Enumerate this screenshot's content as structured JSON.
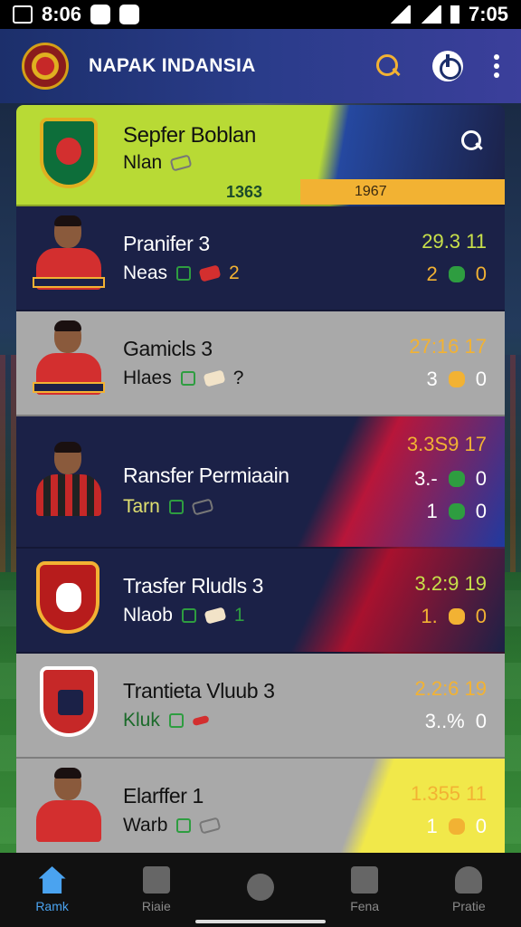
{
  "status_bar": {
    "left_time": "8:06",
    "right_time": "7:05"
  },
  "app_bar": {
    "title": "NAPAK INDANSIA"
  },
  "featured": {
    "name": "Sepfer Boblan",
    "sub": "Nlan",
    "foot_left": "1363",
    "foot_right": "1967"
  },
  "cards": [
    {
      "name": "Pranifer 3",
      "sub": "Neas",
      "sub_num": "2",
      "stat_top": "29.3 11",
      "stat_a": "2",
      "stat_b": "0"
    },
    {
      "name": "Gamicls 3",
      "sub": "Hlaes",
      "sub_num": "?",
      "stat_top": "27:16 17",
      "stat_a": "3",
      "stat_b": "0"
    },
    {
      "name": "Ransfer Permiaain",
      "sub": "Tarn",
      "stat_top": "3.3S9 17",
      "stat_a": "3.-",
      "stat_b": "0",
      "stat_c": "1",
      "stat_d": "0"
    },
    {
      "name": "Trasfer Rludls 3",
      "sub": "Nlaob",
      "sub_num": "1",
      "stat_top": "3.2:9 19",
      "stat_a": "1.",
      "stat_b": "0"
    },
    {
      "name": "Trantieta Vluub 3",
      "sub": "Kluk",
      "stat_top": "2.2:6 19",
      "stat_a": "3..%",
      "stat_b": "0"
    },
    {
      "name": "Elarffer 1",
      "sub": "Warb",
      "stat_top": "1.355 11",
      "stat_a": "1",
      "stat_b": "0"
    }
  ],
  "bottom_nav": [
    {
      "label": "Ramk"
    },
    {
      "label": "Riaie"
    },
    {
      "label": ""
    },
    {
      "label": "Fena"
    },
    {
      "label": "Pratie"
    }
  ],
  "colors": {
    "accent": "#4aa3f0",
    "gold": "#f2b233",
    "lime": "#b8da35",
    "navy": "#1b2147"
  }
}
